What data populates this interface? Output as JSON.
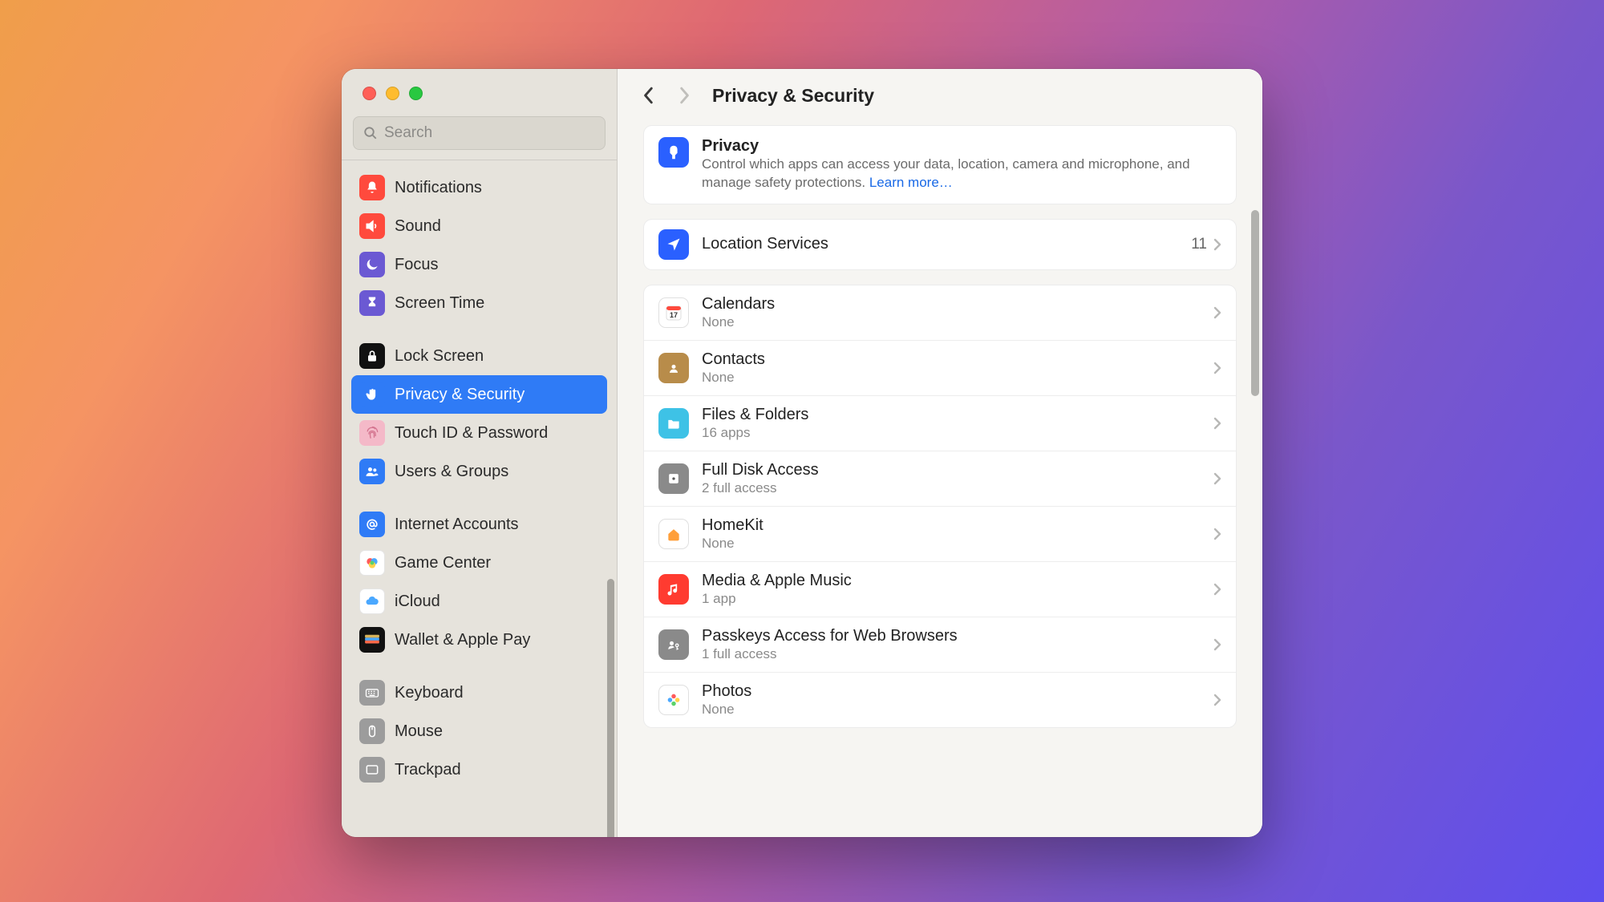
{
  "search": {
    "placeholder": "Search"
  },
  "header": {
    "title": "Privacy & Security"
  },
  "sidebar": {
    "groups": [
      [
        {
          "label": "Notifications",
          "icon": "bell",
          "bg": "#ff4a3d"
        },
        {
          "label": "Sound",
          "icon": "speaker",
          "bg": "#ff4a3d"
        },
        {
          "label": "Focus",
          "icon": "moon",
          "bg": "#6b59d3"
        },
        {
          "label": "Screen Time",
          "icon": "hourglass",
          "bg": "#6b59d3"
        }
      ],
      [
        {
          "label": "Lock Screen",
          "icon": "lock",
          "bg": "#111"
        },
        {
          "label": "Privacy & Security",
          "icon": "hand",
          "bg": "#2f7bf6",
          "selected": true
        },
        {
          "label": "Touch ID & Password",
          "icon": "fingerprint",
          "bg": "#f4b9c8"
        },
        {
          "label": "Users & Groups",
          "icon": "users",
          "bg": "#2f7bf6"
        }
      ],
      [
        {
          "label": "Internet Accounts",
          "icon": "at",
          "bg": "#2f7bf6"
        },
        {
          "label": "Game Center",
          "icon": "gamecenter",
          "bg": "#ffffff"
        },
        {
          "label": "iCloud",
          "icon": "cloud",
          "bg": "#ffffff"
        },
        {
          "label": "Wallet & Apple Pay",
          "icon": "wallet",
          "bg": "#111"
        }
      ],
      [
        {
          "label": "Keyboard",
          "icon": "keyboard",
          "bg": "#9c9c9c"
        },
        {
          "label": "Mouse",
          "icon": "mouse",
          "bg": "#9c9c9c"
        },
        {
          "label": "Trackpad",
          "icon": "trackpad",
          "bg": "#9c9c9c"
        }
      ]
    ]
  },
  "summary": {
    "title": "Privacy",
    "desc": "Control which apps can access your data, location, camera and microphone, and manage safety protections. ",
    "learn_more": "Learn more…"
  },
  "location": {
    "title": "Location Services",
    "value": "11"
  },
  "items": [
    {
      "title": "Calendars",
      "sub": "None",
      "icon": "calendar",
      "bg": "#ffffff"
    },
    {
      "title": "Contacts",
      "sub": "None",
      "icon": "contacts",
      "bg": "#b88c4a"
    },
    {
      "title": "Files & Folders",
      "sub": "16 apps",
      "icon": "folder",
      "bg": "#3ec2e6"
    },
    {
      "title": "Full Disk Access",
      "sub": "2 full access",
      "icon": "disk",
      "bg": "#8a8a8a"
    },
    {
      "title": "HomeKit",
      "sub": "None",
      "icon": "home",
      "bg": "#ffffff"
    },
    {
      "title": "Media & Apple Music",
      "sub": "1 app",
      "icon": "music",
      "bg": "#ff3b30"
    },
    {
      "title": "Passkeys Access for Web Browsers",
      "sub": "1 full access",
      "icon": "passkey",
      "bg": "#8a8a8a"
    },
    {
      "title": "Photos",
      "sub": "None",
      "icon": "photos",
      "bg": "#ffffff"
    }
  ]
}
